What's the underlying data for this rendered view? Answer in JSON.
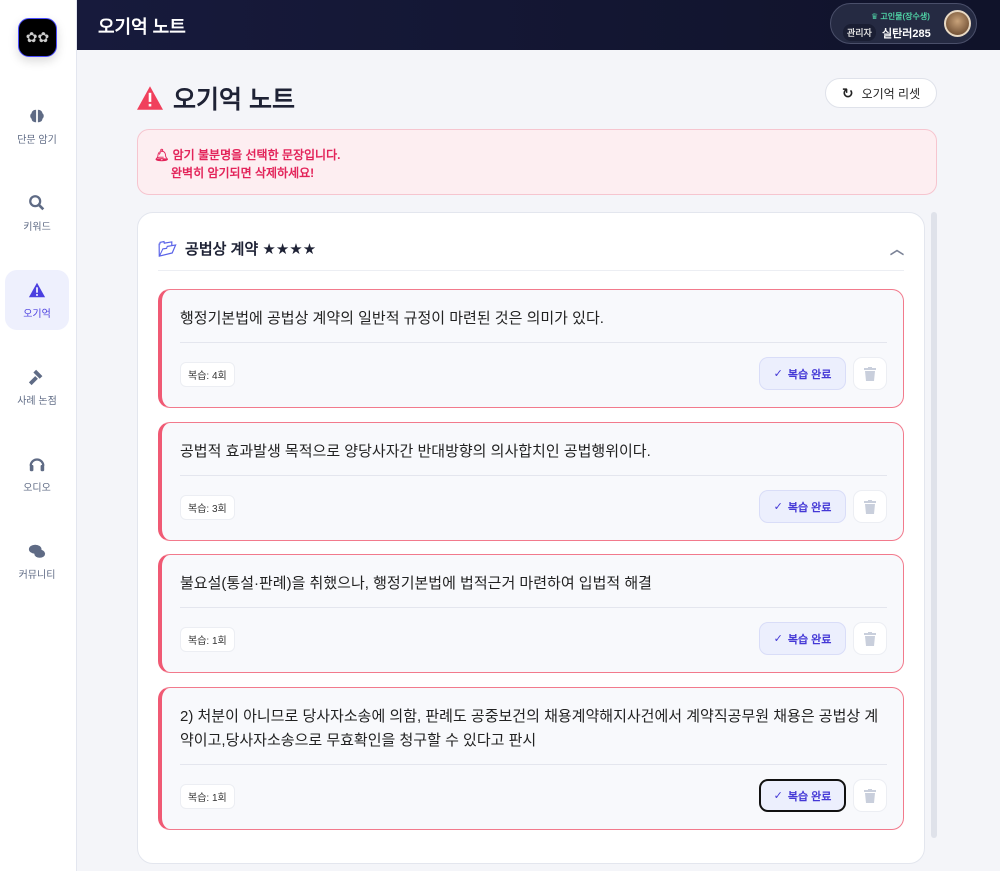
{
  "sidebar": {
    "items": [
      {
        "label": "단문 암기",
        "icon": "brain-icon"
      },
      {
        "label": "키워드",
        "icon": "search-icon"
      },
      {
        "label": "오기억",
        "icon": "warning-icon",
        "active": true
      },
      {
        "label": "사례 논점",
        "icon": "gavel-icon"
      },
      {
        "label": "오디오",
        "icon": "headphones-icon"
      },
      {
        "label": "커뮤니티",
        "icon": "comments-icon"
      }
    ]
  },
  "header": {
    "title": "오기억 노트",
    "user": {
      "grade": "고인물(장수생)",
      "role": "관리자",
      "name": "실탄러285"
    }
  },
  "page": {
    "title": "오기억 노트",
    "reset_label": "오기억 리셋"
  },
  "alert": {
    "line1": "암기 불분명을 선택한 문장입니다.",
    "line2": "완벽히 암기되면 삭제하세요!"
  },
  "section": {
    "title": "공법상 계약 ★★★★"
  },
  "items": [
    {
      "text": "행정기본법에 공법상 계약의 일반적 규정이 마련된 것은 의미가 있다.",
      "count": "복습: 4회",
      "done": "복습 완료"
    },
    {
      "text": "공법적 효과발생 목적으로 양당사자간 반대방향의 의사합치인 공법행위이다.",
      "count": "복습: 3회",
      "done": "복습 완료"
    },
    {
      "text": "불요설(통설·판례)을 취했으나, 행정기본법에 법적근거 마련하여 입법적 해결",
      "count": "복습: 1회",
      "done": "복습 완료"
    },
    {
      "text": "2) 처분이 아니므로 당사자소송에 의함, 판례도 공중보건의 채용계약해지사건에서 계약직공무원 채용은 공법상 계약이고,당사자소송으로 무효확인을 청구할 수 있다고 판시",
      "count": "복습: 1회",
      "done": "복습 완료"
    }
  ]
}
